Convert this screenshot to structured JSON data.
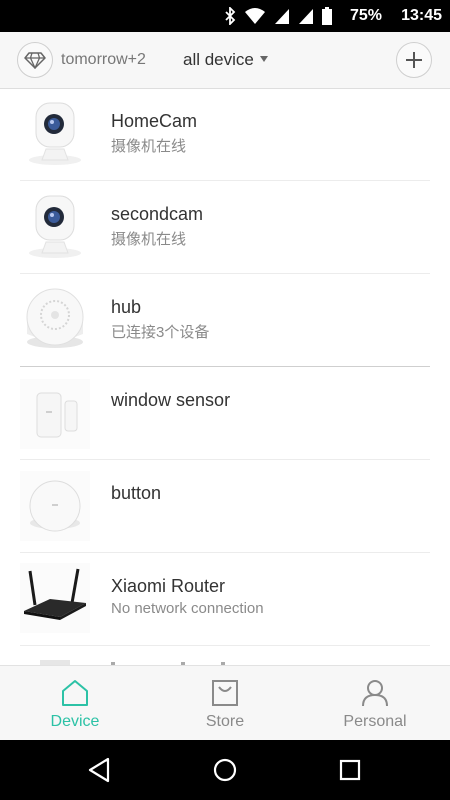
{
  "status_bar": {
    "battery": "75%",
    "time": "13:45",
    "icons": [
      "bluetooth-icon",
      "wifi-icon",
      "signal-icon",
      "signal-icon",
      "battery-icon"
    ]
  },
  "header": {
    "account_name": "tomorrow+2",
    "device_filter": "all device"
  },
  "devices": [
    {
      "name": "HomeCam",
      "status": "摄像机在线",
      "icon": "camera"
    },
    {
      "name": "secondcam",
      "status": "摄像机在线",
      "icon": "camera"
    },
    {
      "name": "hub",
      "status": "已连接3个设备",
      "icon": "hub"
    },
    {
      "name": "window sensor",
      "status": "",
      "icon": "window-sensor"
    },
    {
      "name": "button",
      "status": "",
      "icon": "button"
    },
    {
      "name": "Xiaomi Router",
      "status": "No network connection",
      "icon": "router"
    }
  ],
  "tabs": [
    {
      "label": "Device",
      "icon": "home-icon",
      "active": true
    },
    {
      "label": "Store",
      "icon": "bag-icon",
      "active": false
    },
    {
      "label": "Personal",
      "icon": "person-icon",
      "active": false
    }
  ],
  "colors": {
    "accent": "#2cc2a6",
    "inactive": "#8a8a8a",
    "header_bg": "#f7f7f7"
  }
}
